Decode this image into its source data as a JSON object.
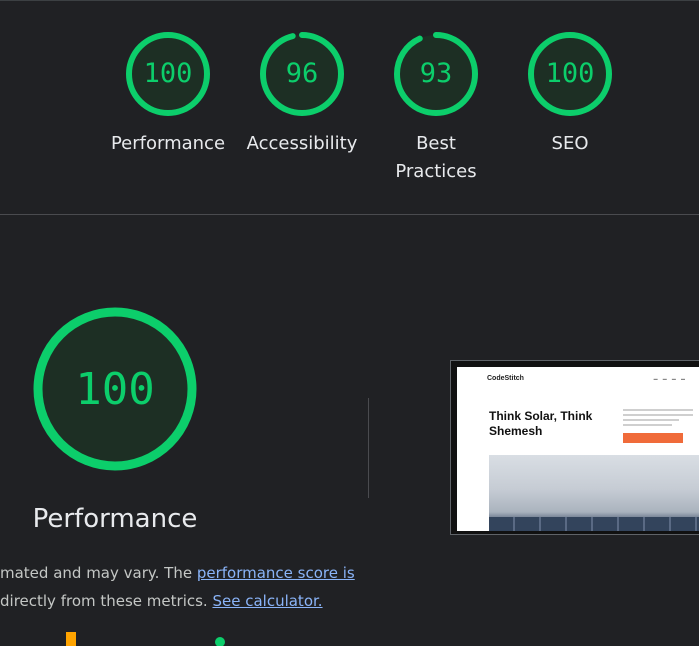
{
  "categories": [
    {
      "score": "100",
      "score_value": 100,
      "label_lines": [
        "Performance"
      ]
    },
    {
      "score": "96",
      "score_value": 96,
      "label_lines": [
        "Accessibility"
      ]
    },
    {
      "score": "93",
      "score_value": 93,
      "label_lines": [
        "Best",
        "Practices"
      ]
    },
    {
      "score": "100",
      "score_value": 100,
      "label_lines": [
        "SEO"
      ]
    }
  ],
  "performance": {
    "score": "100",
    "score_value": 100,
    "title": "Performance",
    "desc_line1_text": "mated and may vary. The ",
    "desc_line1_link": "performance score is",
    "desc_line2_text": "directly from these metrics. ",
    "desc_line2_link": "See calculator."
  },
  "screenshot": {
    "logo": "CodeStitch",
    "heading": "Think Solar, Think Shemesh"
  },
  "colors": {
    "pass": "#0cce6b",
    "gauge_fill": "#1d2f24",
    "background": "#202124",
    "link": "#8ab4f8"
  }
}
